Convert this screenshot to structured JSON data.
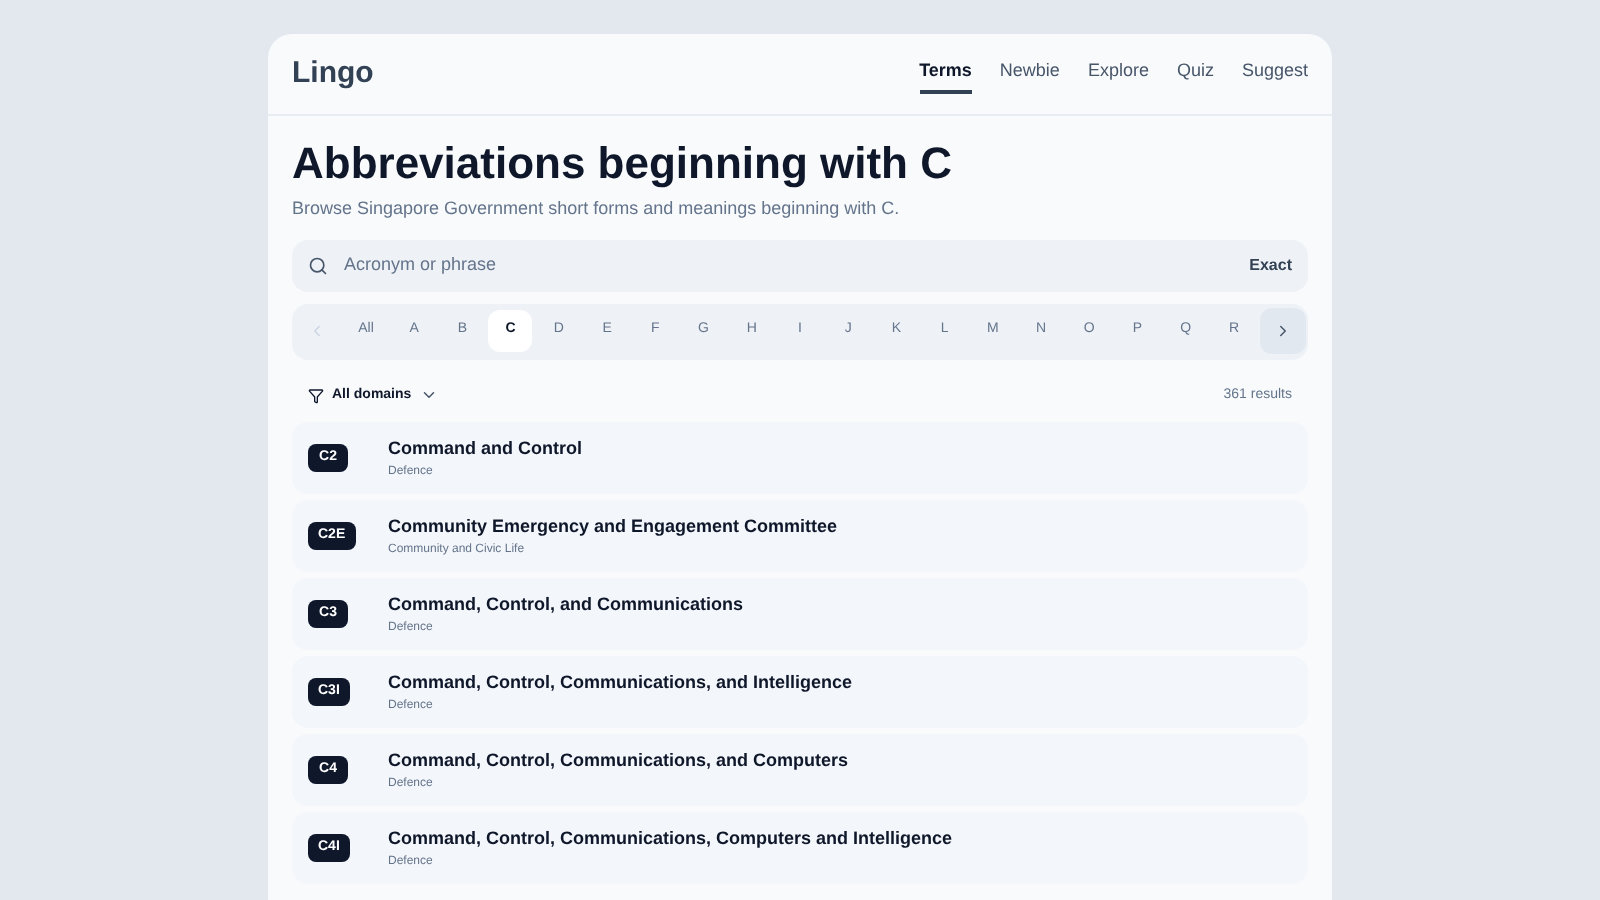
{
  "brand": "Lingo",
  "nav": [
    {
      "label": "Terms",
      "selected": true
    },
    {
      "label": "Newbie",
      "selected": false
    },
    {
      "label": "Explore",
      "selected": false
    },
    {
      "label": "Quiz",
      "selected": false
    },
    {
      "label": "Suggest",
      "selected": false
    }
  ],
  "heading": "Abbreviations beginning with C",
  "subheading": "Browse Singapore Government short forms and meanings beginning with C.",
  "search": {
    "placeholder": "Acronym or phrase",
    "mode": "Exact"
  },
  "letters": {
    "prev_disabled": true,
    "next_disabled": false,
    "items": [
      {
        "label": "All",
        "selected": false
      },
      {
        "label": "A",
        "selected": false
      },
      {
        "label": "B",
        "selected": false
      },
      {
        "label": "C",
        "selected": true
      },
      {
        "label": "D",
        "selected": false
      },
      {
        "label": "E",
        "selected": false
      },
      {
        "label": "F",
        "selected": false
      },
      {
        "label": "G",
        "selected": false
      },
      {
        "label": "H",
        "selected": false
      },
      {
        "label": "I",
        "selected": false
      },
      {
        "label": "J",
        "selected": false
      },
      {
        "label": "K",
        "selected": false
      },
      {
        "label": "L",
        "selected": false
      },
      {
        "label": "M",
        "selected": false
      },
      {
        "label": "N",
        "selected": false
      },
      {
        "label": "O",
        "selected": false
      },
      {
        "label": "P",
        "selected": false
      },
      {
        "label": "Q",
        "selected": false
      },
      {
        "label": "R",
        "selected": false
      }
    ]
  },
  "filter": {
    "label": "All domains",
    "count": "361 results"
  },
  "results": [
    {
      "abbr": "C2",
      "meaning": "Command and Control",
      "domain": "Defence"
    },
    {
      "abbr": "C2E",
      "meaning": "Community Emergency and Engagement Committee",
      "domain": "Community and Civic Life"
    },
    {
      "abbr": "C3",
      "meaning": "Command, Control, and Communications",
      "domain": "Defence"
    },
    {
      "abbr": "C3I",
      "meaning": "Command, Control, Communications, and Intelligence",
      "domain": "Defence"
    },
    {
      "abbr": "C4",
      "meaning": "Command, Control, Communications, and Computers",
      "domain": "Defence"
    },
    {
      "abbr": "C4I",
      "meaning": "Command, Control, Communications, Computers and Intelligence",
      "domain": "Defence"
    }
  ]
}
